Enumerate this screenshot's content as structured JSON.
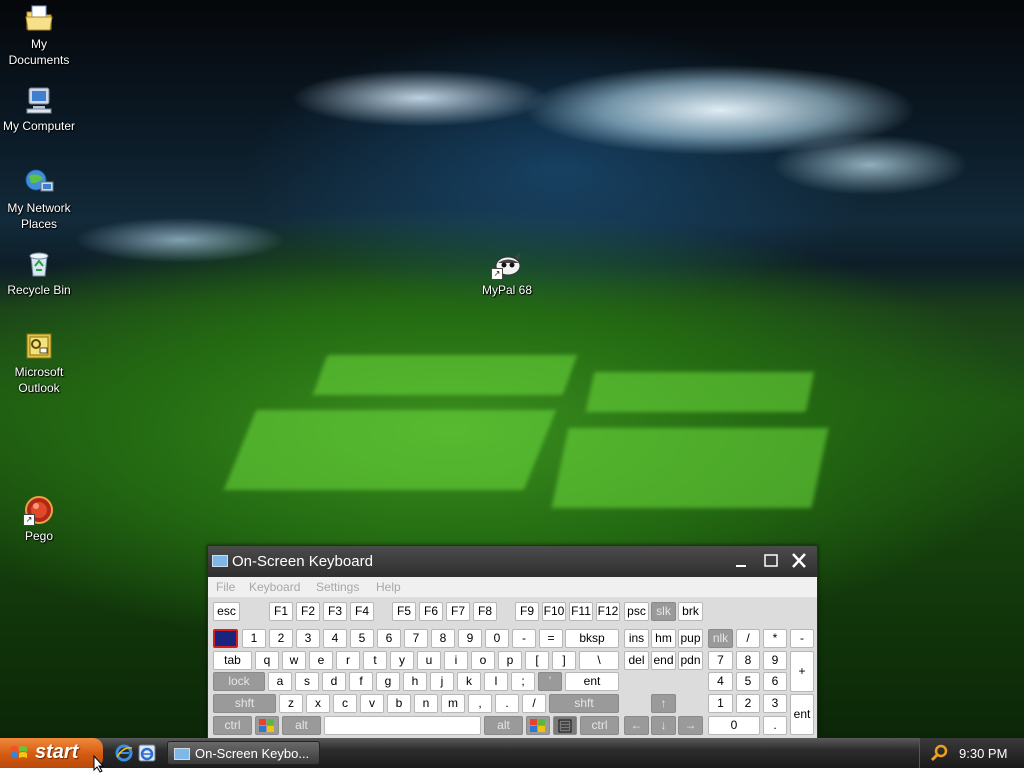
{
  "desktop_icons": [
    {
      "label": "My Documents",
      "icon": "my-documents-icon"
    },
    {
      "label": "My Computer",
      "icon": "my-computer-icon"
    },
    {
      "label": "My Network Places",
      "icon": "network-places-icon"
    },
    {
      "label": "Recycle Bin",
      "icon": "recycle-bin-icon"
    },
    {
      "label": "Microsoft Outlook",
      "icon": "outlook-icon"
    },
    {
      "label": "Pego",
      "icon": "pego-icon"
    },
    {
      "label": "MyPal 68",
      "icon": "mypal-icon"
    }
  ],
  "osk": {
    "title": "On-Screen Keyboard",
    "menu": [
      "File",
      "Keyboard",
      "Settings",
      "Help"
    ],
    "keys": [
      [
        "esc",
        "F1",
        "F2",
        "F3",
        "F4",
        "F5",
        "F6",
        "F7",
        "F8",
        "F9",
        "F10",
        "F11",
        "F12",
        "psc",
        "slk",
        "brk"
      ],
      [
        "",
        "1",
        "2",
        "3",
        "4",
        "5",
        "6",
        "7",
        "8",
        "9",
        "0",
        "-",
        "=",
        "bksp",
        "ins",
        "hm",
        "pup",
        "nlk",
        "/",
        "*",
        "-"
      ],
      [
        "tab",
        "q",
        "w",
        "e",
        "r",
        "t",
        "y",
        "u",
        "i",
        "o",
        "p",
        "[",
        "]",
        "\\",
        "del",
        "end",
        "pdn",
        "7",
        "8",
        "9",
        "+"
      ],
      [
        "lock",
        "a",
        "s",
        "d",
        "f",
        "g",
        "h",
        "j",
        "k",
        "l",
        ";",
        "'",
        "ent",
        "4",
        "5",
        "6"
      ],
      [
        "shft",
        "z",
        "x",
        "c",
        "v",
        "b",
        "n",
        "m",
        ",",
        ".",
        "/",
        "shft",
        "↑",
        "1",
        "2",
        "3",
        "ent"
      ],
      [
        "ctrl",
        "",
        "alt",
        "",
        "alt",
        "",
        "",
        "ctrl",
        "←",
        "↓",
        "→",
        "0",
        "."
      ]
    ]
  },
  "taskbar": {
    "start_label": "start",
    "task_label": "On-Screen Keybo...",
    "clock": "9:30 PM"
  }
}
